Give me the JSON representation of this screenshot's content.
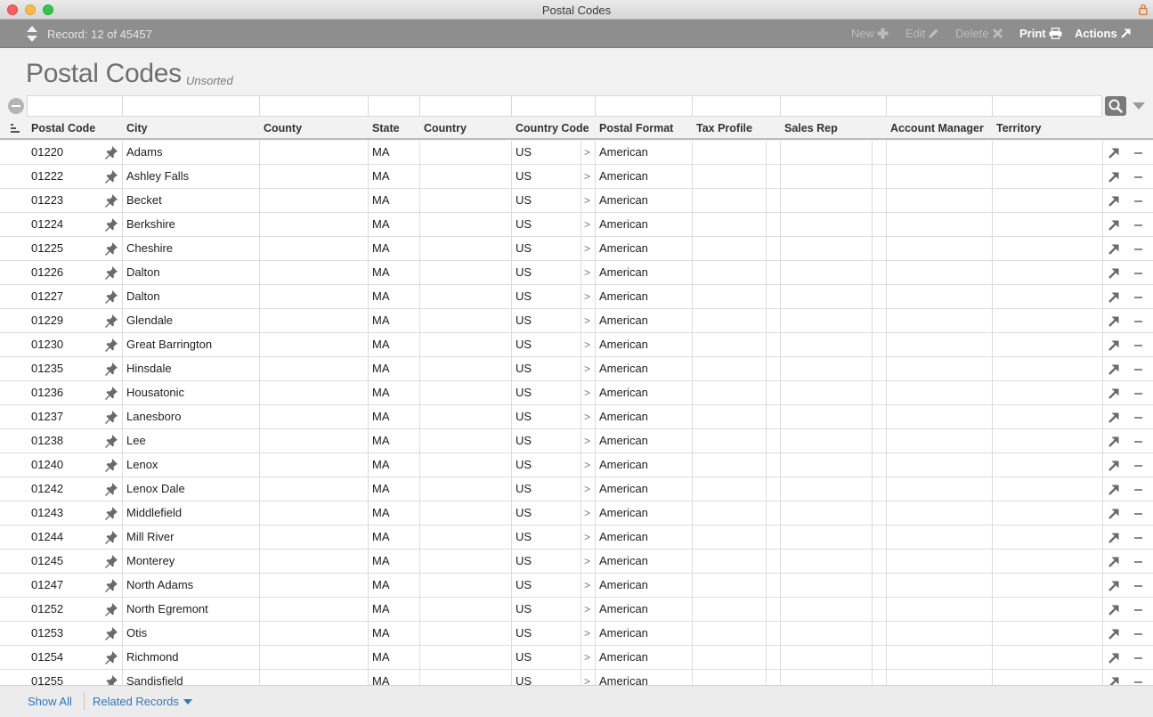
{
  "window": {
    "title": "Postal Codes"
  },
  "toolbar": {
    "record_label": "Record: 12 of 45457",
    "new_label": "New",
    "edit_label": "Edit",
    "delete_label": "Delete",
    "print_label": "Print",
    "actions_label": "Actions"
  },
  "page": {
    "title": "Postal Codes",
    "sort_status": "Unsorted"
  },
  "table": {
    "columns": [
      "Postal Code",
      "City",
      "County",
      "State",
      "Country",
      "Country Code",
      "Postal Format",
      "Tax Profile",
      "Sales Rep",
      "Account Manager",
      "Territory"
    ],
    "rows": [
      {
        "postal_code": "01220",
        "city": "Adams",
        "county": "",
        "state": "MA",
        "country": "",
        "country_code": "US",
        "postal_format": "American"
      },
      {
        "postal_code": "01222",
        "city": "Ashley Falls",
        "county": "",
        "state": "MA",
        "country": "",
        "country_code": "US",
        "postal_format": "American"
      },
      {
        "postal_code": "01223",
        "city": "Becket",
        "county": "",
        "state": "MA",
        "country": "",
        "country_code": "US",
        "postal_format": "American"
      },
      {
        "postal_code": "01224",
        "city": "Berkshire",
        "county": "",
        "state": "MA",
        "country": "",
        "country_code": "US",
        "postal_format": "American"
      },
      {
        "postal_code": "01225",
        "city": "Cheshire",
        "county": "",
        "state": "MA",
        "country": "",
        "country_code": "US",
        "postal_format": "American"
      },
      {
        "postal_code": "01226",
        "city": "Dalton",
        "county": "",
        "state": "MA",
        "country": "",
        "country_code": "US",
        "postal_format": "American"
      },
      {
        "postal_code": "01227",
        "city": "Dalton",
        "county": "",
        "state": "MA",
        "country": "",
        "country_code": "US",
        "postal_format": "American"
      },
      {
        "postal_code": "01229",
        "city": "Glendale",
        "county": "",
        "state": "MA",
        "country": "",
        "country_code": "US",
        "postal_format": "American"
      },
      {
        "postal_code": "01230",
        "city": "Great Barrington",
        "county": "",
        "state": "MA",
        "country": "",
        "country_code": "US",
        "postal_format": "American"
      },
      {
        "postal_code": "01235",
        "city": "Hinsdale",
        "county": "",
        "state": "MA",
        "country": "",
        "country_code": "US",
        "postal_format": "American"
      },
      {
        "postal_code": "01236",
        "city": "Housatonic",
        "county": "",
        "state": "MA",
        "country": "",
        "country_code": "US",
        "postal_format": "American"
      },
      {
        "postal_code": "01237",
        "city": "Lanesboro",
        "county": "",
        "state": "MA",
        "country": "",
        "country_code": "US",
        "postal_format": "American"
      },
      {
        "postal_code": "01238",
        "city": "Lee",
        "county": "",
        "state": "MA",
        "country": "",
        "country_code": "US",
        "postal_format": "American"
      },
      {
        "postal_code": "01240",
        "city": "Lenox",
        "county": "",
        "state": "MA",
        "country": "",
        "country_code": "US",
        "postal_format": "American"
      },
      {
        "postal_code": "01242",
        "city": "Lenox Dale",
        "county": "",
        "state": "MA",
        "country": "",
        "country_code": "US",
        "postal_format": "American"
      },
      {
        "postal_code": "01243",
        "city": "Middlefield",
        "county": "",
        "state": "MA",
        "country": "",
        "country_code": "US",
        "postal_format": "American"
      },
      {
        "postal_code": "01244",
        "city": "Mill River",
        "county": "",
        "state": "MA",
        "country": "",
        "country_code": "US",
        "postal_format": "American"
      },
      {
        "postal_code": "01245",
        "city": "Monterey",
        "county": "",
        "state": "MA",
        "country": "",
        "country_code": "US",
        "postal_format": "American"
      },
      {
        "postal_code": "01247",
        "city": "North Adams",
        "county": "",
        "state": "MA",
        "country": "",
        "country_code": "US",
        "postal_format": "American"
      },
      {
        "postal_code": "01252",
        "city": "North Egremont",
        "county": "",
        "state": "MA",
        "country": "",
        "country_code": "US",
        "postal_format": "American"
      },
      {
        "postal_code": "01253",
        "city": "Otis",
        "county": "",
        "state": "MA",
        "country": "",
        "country_code": "US",
        "postal_format": "American"
      },
      {
        "postal_code": "01254",
        "city": "Richmond",
        "county": "",
        "state": "MA",
        "country": "",
        "country_code": "US",
        "postal_format": "American"
      },
      {
        "postal_code": "01255",
        "city": "Sandisfield",
        "county": "",
        "state": "MA",
        "country": "",
        "country_code": "US",
        "postal_format": "American"
      }
    ]
  },
  "footer": {
    "show_all": "Show All",
    "related_records": "Related Records"
  },
  "colors": {
    "toolbar_bg": "#8e8e8e",
    "link": "#2a79c1",
    "close": "#fc605c",
    "minimize": "#fdbc40",
    "maximize": "#34c84a"
  },
  "icons": [
    "lock-icon",
    "record-nav-icon",
    "plus-icon",
    "pencil-icon",
    "x-icon",
    "printer-icon",
    "open-arrow-icon",
    "pin-icon",
    "search-icon",
    "sort-icon",
    "clear-filter-icon",
    "remove-icon"
  ]
}
